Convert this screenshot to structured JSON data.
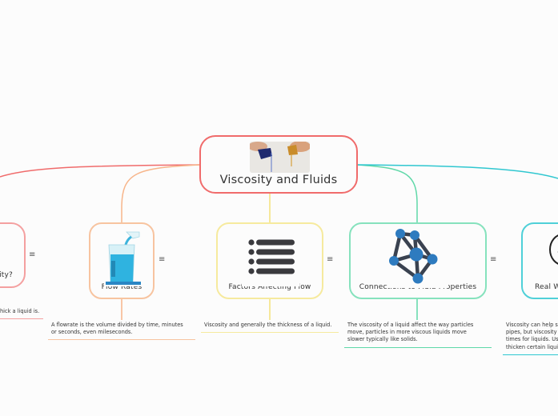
{
  "central": {
    "title": "Viscosity and Fluids",
    "image": "pouring-liquids-photo",
    "color": "#f06b6b"
  },
  "branches": [
    {
      "title": "What is Viscosity?",
      "visible_title": "ity?",
      "color": "#f08a8a",
      "note": "Viscosity is how thick a liquid is.",
      "visible_note": "hick a liquid is.",
      "icon": "unknown-image"
    },
    {
      "title": "Flow Rates",
      "color": "#f7b58a",
      "note": "A flowrate is the volume divided by time, minutes or seconds, even mileseconds.",
      "note_lines": [
        "A flowrate is the volume divided by time, minutes",
        "or seconds, even mileseconds."
      ],
      "icon": "beaker-pouring-image"
    },
    {
      "title": "Factors Affecting Flow",
      "color": "#f4e27a",
      "note": "Viscosity and generally the thickness of a liquid.",
      "icon": "bulleted-list-icon"
    },
    {
      "title": "Connections to Fluid Properties",
      "color": "#5fd8a8",
      "note": "The viscosity of a liquid affect the way particles move, particles in more viscous liquids move slower  typically like solids.",
      "note_lines": [
        "The viscosity of a liquid affect the way particles",
        "move, particles in more viscous liquids move",
        "slower  typically like solids."
      ],
      "icon": "network-molecule-icon"
    },
    {
      "title": "Real W",
      "color": "#2fc7d0",
      "note_lines": [
        "Viscosity can help s",
        "pipes, but viscosity",
        "times for liquids. Us",
        "thicken certain liqui"
      ],
      "icon": "globe-hand-icon"
    }
  ],
  "menu_glyph": "≡"
}
